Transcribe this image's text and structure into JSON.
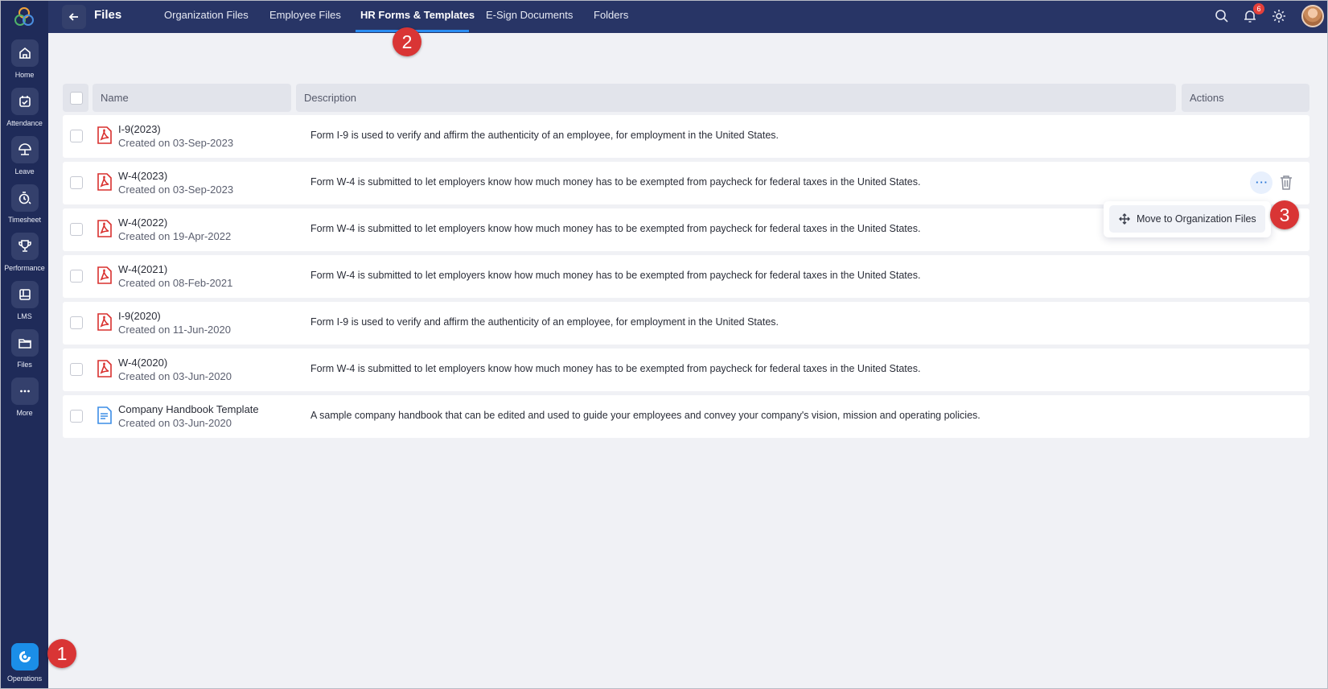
{
  "topbar": {
    "title": "Files",
    "tabs": [
      {
        "label": "Organization Files"
      },
      {
        "label": "Employee Files"
      },
      {
        "label": "HR Forms & Templates",
        "active": true
      },
      {
        "label": "E-Sign Documents"
      },
      {
        "label": "Folders"
      }
    ],
    "notification_count": "6"
  },
  "sidebar": {
    "items": [
      {
        "label": "Home",
        "icon": "home-icon"
      },
      {
        "label": "Attendance",
        "icon": "calendar-check-icon"
      },
      {
        "label": "Leave",
        "icon": "umbrella-icon"
      },
      {
        "label": "Timesheet",
        "icon": "timer-icon"
      },
      {
        "label": "Performance",
        "icon": "trophy-icon"
      },
      {
        "label": "LMS",
        "icon": "book-icon"
      },
      {
        "label": "Files",
        "icon": "folder-icon"
      },
      {
        "label": "More",
        "icon": "more-dots-icon"
      }
    ],
    "operations": {
      "label": "Operations",
      "icon": "operations-icon"
    }
  },
  "table": {
    "headers": {
      "name": "Name",
      "description": "Description",
      "actions": "Actions"
    },
    "rows": [
      {
        "name": "I-9(2023)",
        "created": "Created on 03-Sep-2023",
        "description": "Form I-9 is used to verify and affirm the authenticity of an employee, for employment in the United States.",
        "type": "pdf"
      },
      {
        "name": "W-4(2023)",
        "created": "Created on 03-Sep-2023",
        "description": "Form W-4 is submitted to let employers know how much money has to be exempted from paycheck for federal taxes in the United States.",
        "type": "pdf"
      },
      {
        "name": "W-4(2022)",
        "created": "Created on 19-Apr-2022",
        "description": "Form W-4 is submitted to let employers know how much money has to be exempted from paycheck for federal taxes in the United States.",
        "type": "pdf"
      },
      {
        "name": "W-4(2021)",
        "created": "Created on 08-Feb-2021",
        "description": "Form W-4 is submitted to let employers know how much money has to be exempted from paycheck for federal taxes in the United States.",
        "type": "pdf"
      },
      {
        "name": "I-9(2020)",
        "created": "Created on 11-Jun-2020",
        "description": "Form I-9 is used to verify and affirm the authenticity of an employee, for employment in the United States.",
        "type": "pdf"
      },
      {
        "name": "W-4(2020)",
        "created": "Created on 03-Jun-2020",
        "description": "Form W-4 is submitted to let employers know how much money has to be exempted from paycheck for federal taxes in the United States.",
        "type": "pdf"
      },
      {
        "name": "Company Handbook Template",
        "created": "Created on 03-Jun-2020",
        "description": "A sample company handbook that can be edited and used to guide your employees and convey your company's vision, mission and operating policies.",
        "type": "doc"
      }
    ]
  },
  "context_menu": {
    "move_label": "Move to Organization Files"
  },
  "steps": {
    "one": "1",
    "two": "2",
    "three": "3"
  },
  "colors": {
    "sidebar": "#1f2b59",
    "topbar": "#283566",
    "accent": "#2a8df2",
    "step_marker": "#d93535",
    "pdf_icon": "#d9302e",
    "doc_icon": "#3d8ee6"
  }
}
